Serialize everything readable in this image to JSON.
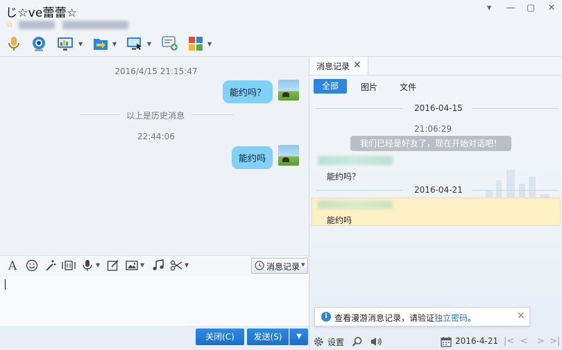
{
  "window": {
    "title": "じ☆ve蕾蕾☆",
    "star_badge": "☆",
    "controls": [
      "▾",
      "—",
      "▢",
      "✕"
    ]
  },
  "toolbar": {
    "icons": [
      "microphone-icon",
      "video-call-icon",
      "screen-share-icon",
      "file-transfer-icon",
      "remote-desktop-icon",
      "new-discussion-icon",
      "apps-icon"
    ]
  },
  "chat": {
    "messages": [
      {
        "time": "2016/4/15 21:15:47",
        "text": "能约吗？"
      },
      {
        "time": "22:44:06",
        "text": "能约吗"
      }
    ],
    "history_divider": "以上是历史消息"
  },
  "input_toolbar": {
    "font_icon": "A",
    "history_button": "消息记录"
  },
  "actions": {
    "close_label": "关闭(C)",
    "send_label": "发送(S)",
    "send_dropdown": "▼"
  },
  "history_panel": {
    "tab_label": "消息记录",
    "filters": [
      "全部",
      "图片",
      "文件"
    ],
    "groups": [
      {
        "date": "2016-04-15",
        "time": "21:06:29",
        "system": "我们已经是好友了，现在开始对话吧！",
        "message": "能约吗？"
      },
      {
        "date": "2016-04-21",
        "message": "能约吗"
      }
    ],
    "notice_prefix": "查看漫游消息记录，请验证",
    "notice_link": "独立密码",
    "notice_suffix": "。",
    "settings_label": "设置",
    "date_value": "2016-4-21"
  },
  "colors": {
    "accent": "#2b86e0",
    "bubble": "#7fd1f5",
    "highlight_row": "#fdf0c5"
  }
}
